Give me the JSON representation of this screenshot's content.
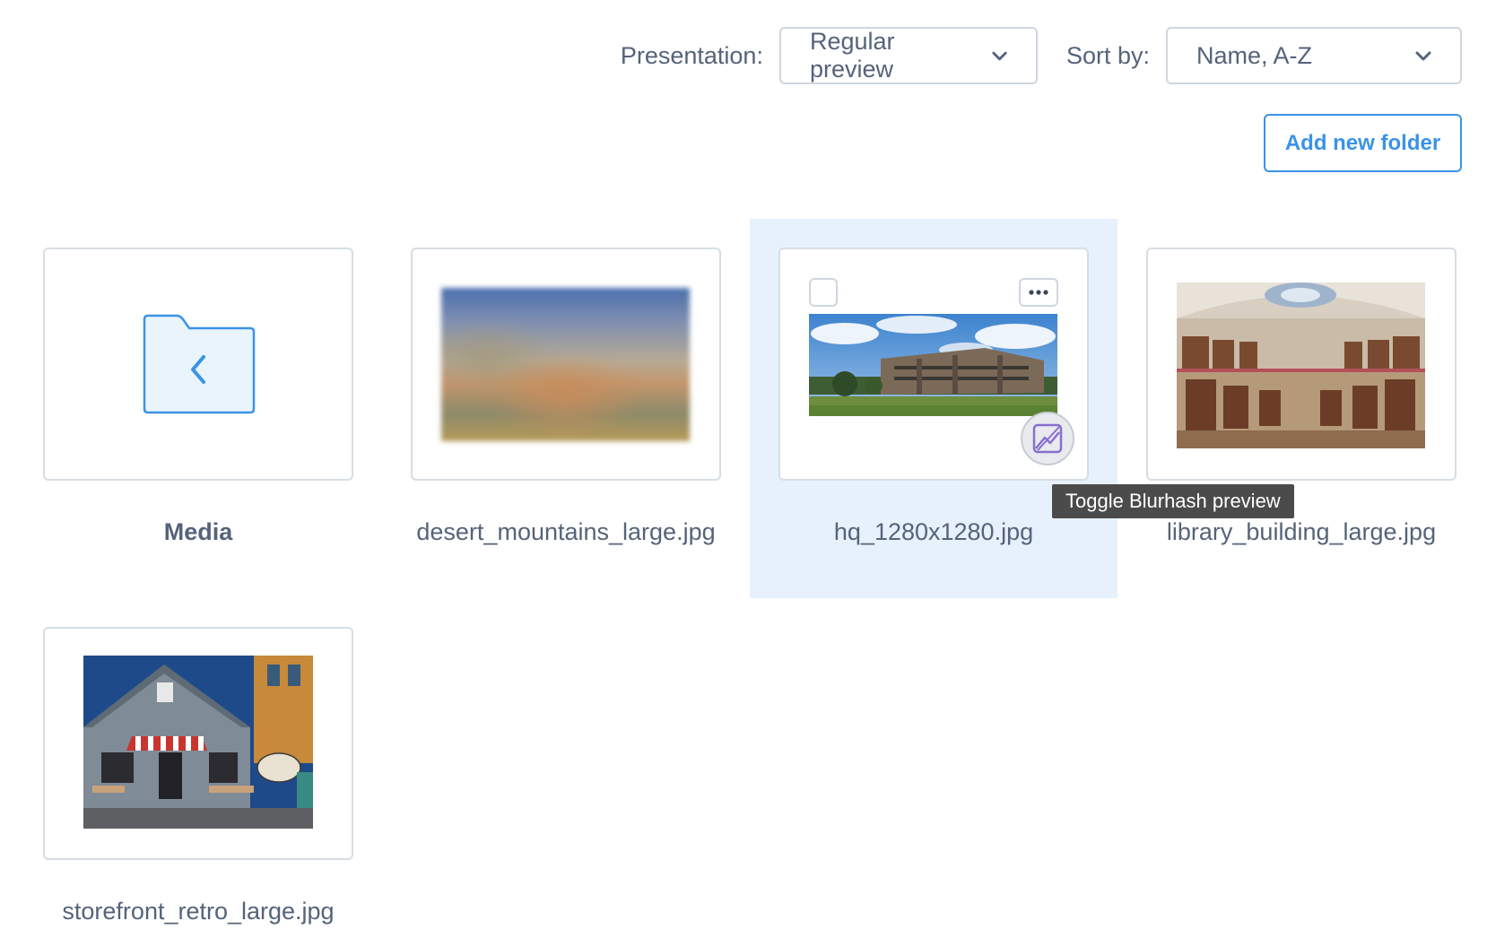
{
  "toolbar": {
    "presentation_label": "Presentation:",
    "presentation_value": "Regular preview",
    "sort_label": "Sort by:",
    "sort_value": "Name, A-Z"
  },
  "actions": {
    "add_folder_label": "Add new folder"
  },
  "items": [
    {
      "name": "Media",
      "kind": "folder-up"
    },
    {
      "name": "desert_mountains_large.jpg",
      "kind": "image",
      "preview": "blurhash"
    },
    {
      "name": "hq_1280x1280.jpg",
      "kind": "image",
      "selected": true
    },
    {
      "name": "library_building_large.jpg",
      "kind": "image"
    },
    {
      "name": "storefront_retro_large.jpg",
      "kind": "image"
    }
  ],
  "tooltip": {
    "text": "Toggle Blurhash preview"
  },
  "icons": {
    "chevron": "chevron-down-icon",
    "folder": "folder-back-icon",
    "more": "more-dots-icon",
    "blurhash": "image-toggle-icon"
  },
  "colors": {
    "accent": "#3a93e6",
    "selected_bg": "#e6f1fc",
    "border": "#d7dde4",
    "text": "#55637a",
    "tooltip_bg": "#4b4b4b"
  }
}
